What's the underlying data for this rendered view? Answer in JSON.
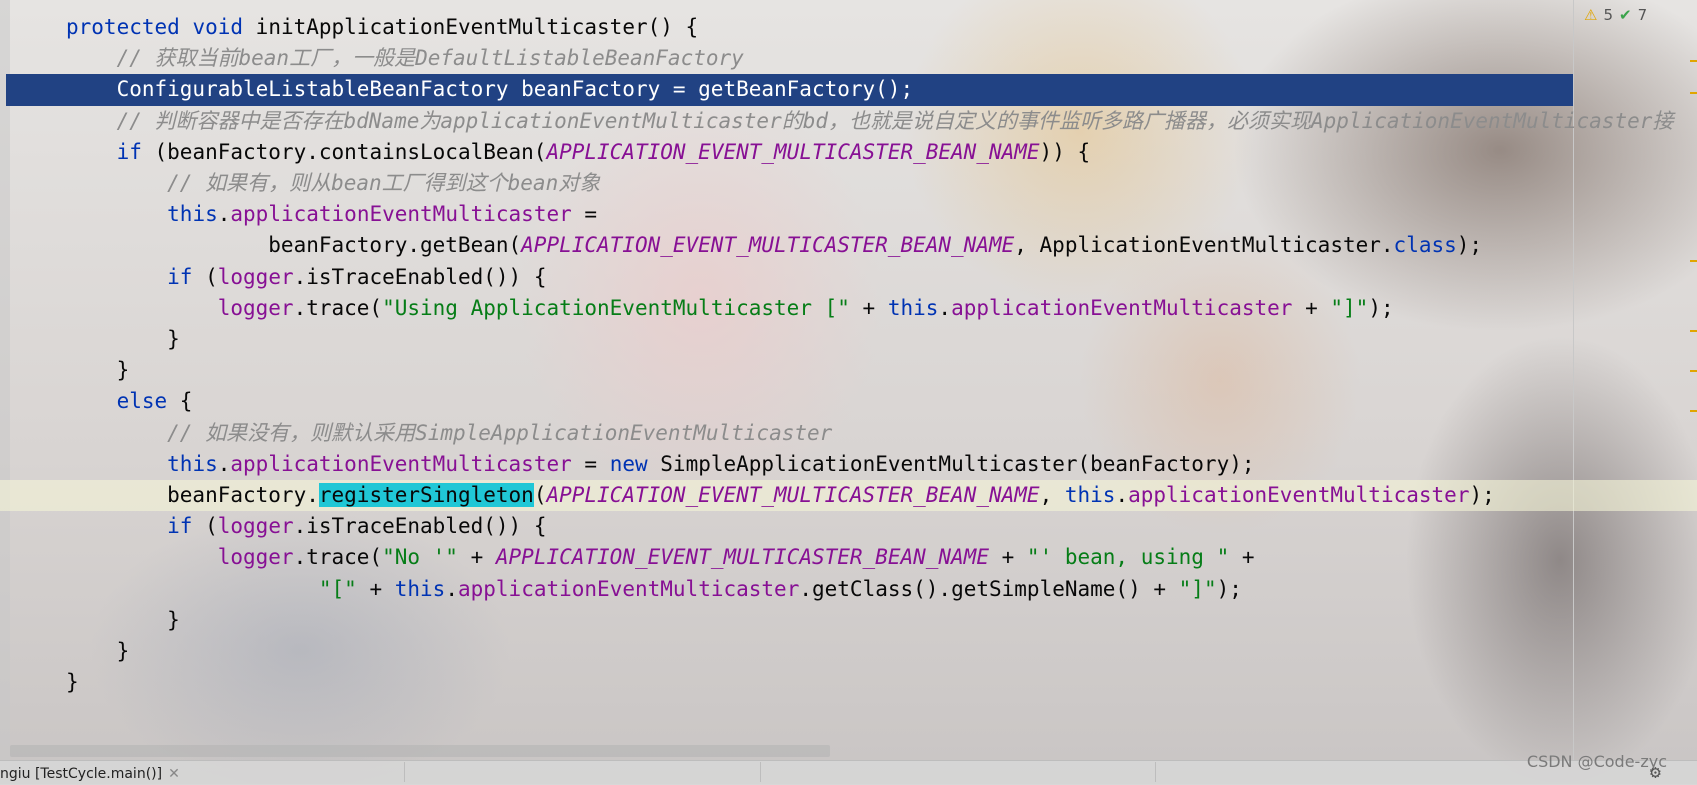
{
  "editor": {
    "lines": [
      {
        "top": 0,
        "segs": [
          {
            "c": "kw",
            "t": "protected"
          },
          {
            "c": "",
            "t": " "
          },
          {
            "c": "kw",
            "t": "void"
          },
          {
            "c": "",
            "t": " initApplicationEventMulticaster() {"
          }
        ]
      },
      {
        "segs": [
          {
            "c": "cmt",
            "t": "    // 获取当前bean工厂，一般是DefaultListableBeanFactory"
          }
        ]
      },
      {
        "selected": true,
        "segs": [
          {
            "c": "",
            "t": "    ConfigurableListableBeanFactory beanFactory = getBeanFactory();"
          }
        ]
      },
      {
        "segs": [
          {
            "c": "cmt",
            "t": "    // 判断容器中是否存在bdName为applicationEventMulticaster的bd，也就是说自定义的事件监听多路广播器，必须实现ApplicationEventMulticaster接"
          }
        ]
      },
      {
        "segs": [
          {
            "c": "",
            "t": "    "
          },
          {
            "c": "kw",
            "t": "if"
          },
          {
            "c": "",
            "t": " (beanFactory.containsLocalBean("
          },
          {
            "c": "const",
            "t": "APPLICATION_EVENT_MULTICASTER_BEAN_NAME"
          },
          {
            "c": "",
            "t": ")) {"
          }
        ]
      },
      {
        "segs": [
          {
            "c": "cmt",
            "t": "        // 如果有，则从bean工厂得到这个bean对象"
          }
        ]
      },
      {
        "segs": [
          {
            "c": "",
            "t": "        "
          },
          {
            "c": "kw",
            "t": "this"
          },
          {
            "c": "",
            "t": "."
          },
          {
            "c": "fld",
            "t": "applicationEventMulticaster"
          },
          {
            "c": "",
            "t": " ="
          }
        ]
      },
      {
        "segs": [
          {
            "c": "",
            "t": "                beanFactory.getBean("
          },
          {
            "c": "const",
            "t": "APPLICATION_EVENT_MULTICASTER_BEAN_NAME"
          },
          {
            "c": "",
            "t": ", ApplicationEventMulticaster."
          },
          {
            "c": "kw",
            "t": "class"
          },
          {
            "c": "",
            "t": ");"
          }
        ]
      },
      {
        "segs": [
          {
            "c": "",
            "t": "        "
          },
          {
            "c": "kw",
            "t": "if"
          },
          {
            "c": "",
            "t": " ("
          },
          {
            "c": "fld",
            "t": "logger"
          },
          {
            "c": "",
            "t": ".isTraceEnabled()) {"
          }
        ]
      },
      {
        "segs": [
          {
            "c": "",
            "t": "            "
          },
          {
            "c": "fld",
            "t": "logger"
          },
          {
            "c": "",
            "t": ".trace("
          },
          {
            "c": "str",
            "t": "\"Using ApplicationEventMulticaster [\""
          },
          {
            "c": "",
            "t": " + "
          },
          {
            "c": "kw",
            "t": "this"
          },
          {
            "c": "",
            "t": "."
          },
          {
            "c": "fld",
            "t": "applicationEventMulticaster"
          },
          {
            "c": "",
            "t": " + "
          },
          {
            "c": "str",
            "t": "\"]\""
          },
          {
            "c": "",
            "t": ");"
          }
        ]
      },
      {
        "segs": [
          {
            "c": "",
            "t": "        }"
          }
        ]
      },
      {
        "segs": [
          {
            "c": "",
            "t": "    }"
          }
        ]
      },
      {
        "segs": [
          {
            "c": "",
            "t": "    "
          },
          {
            "c": "kw",
            "t": "else"
          },
          {
            "c": "",
            "t": " {"
          }
        ]
      },
      {
        "segs": [
          {
            "c": "cmt",
            "t": "        // 如果没有，则默认采用SimpleApplicationEventMulticaster"
          }
        ]
      },
      {
        "segs": [
          {
            "c": "",
            "t": "        "
          },
          {
            "c": "kw",
            "t": "this"
          },
          {
            "c": "",
            "t": "."
          },
          {
            "c": "fld",
            "t": "applicationEventMulticaster"
          },
          {
            "c": "",
            "t": " = "
          },
          {
            "c": "kw",
            "t": "new"
          },
          {
            "c": "",
            "t": " SimpleApplicationEventMulticaster(beanFactory);"
          }
        ]
      },
      {
        "caret": true,
        "segs": [
          {
            "c": "",
            "t": "        beanFactory."
          },
          {
            "c": "hl",
            "t": "registerSingleton"
          },
          {
            "c": "",
            "t": "("
          },
          {
            "c": "const",
            "t": "APPLICATION_EVENT_MULTICASTER_BEAN_NAME"
          },
          {
            "c": "",
            "t": ", "
          },
          {
            "c": "kw",
            "t": "this"
          },
          {
            "c": "",
            "t": "."
          },
          {
            "c": "fld",
            "t": "applicationEventMulticaster"
          },
          {
            "c": "",
            "t": ");"
          }
        ]
      },
      {
        "segs": [
          {
            "c": "",
            "t": "        "
          },
          {
            "c": "kw",
            "t": "if"
          },
          {
            "c": "",
            "t": " ("
          },
          {
            "c": "fld",
            "t": "logger"
          },
          {
            "c": "",
            "t": ".isTraceEnabled()) {"
          }
        ]
      },
      {
        "segs": [
          {
            "c": "",
            "t": "            "
          },
          {
            "c": "fld",
            "t": "logger"
          },
          {
            "c": "",
            "t": ".trace("
          },
          {
            "c": "str",
            "t": "\"No '\""
          },
          {
            "c": "",
            "t": " + "
          },
          {
            "c": "const",
            "t": "APPLICATION_EVENT_MULTICASTER_BEAN_NAME"
          },
          {
            "c": "",
            "t": " + "
          },
          {
            "c": "str",
            "t": "\"' bean, using \""
          },
          {
            "c": "",
            "t": " +"
          }
        ]
      },
      {
        "segs": [
          {
            "c": "",
            "t": "                    "
          },
          {
            "c": "str",
            "t": "\"[\""
          },
          {
            "c": "",
            "t": " + "
          },
          {
            "c": "kw",
            "t": "this"
          },
          {
            "c": "",
            "t": "."
          },
          {
            "c": "fld",
            "t": "applicationEventMulticaster"
          },
          {
            "c": "",
            "t": ".getClass().getSimpleName() + "
          },
          {
            "c": "str",
            "t": "\"]\""
          },
          {
            "c": "",
            "t": ");"
          }
        ]
      },
      {
        "segs": [
          {
            "c": "",
            "t": "        }"
          }
        ]
      },
      {
        "segs": [
          {
            "c": "",
            "t": "    }"
          }
        ]
      },
      {
        "segs": [
          {
            "c": "",
            "t": "}"
          }
        ]
      }
    ]
  },
  "inspections": {
    "warnings": "5",
    "ok": "7"
  },
  "status": {
    "tab_label": "ngiu [TestCycle.main()]",
    "watermark": "CSDN @Code-zyc"
  }
}
